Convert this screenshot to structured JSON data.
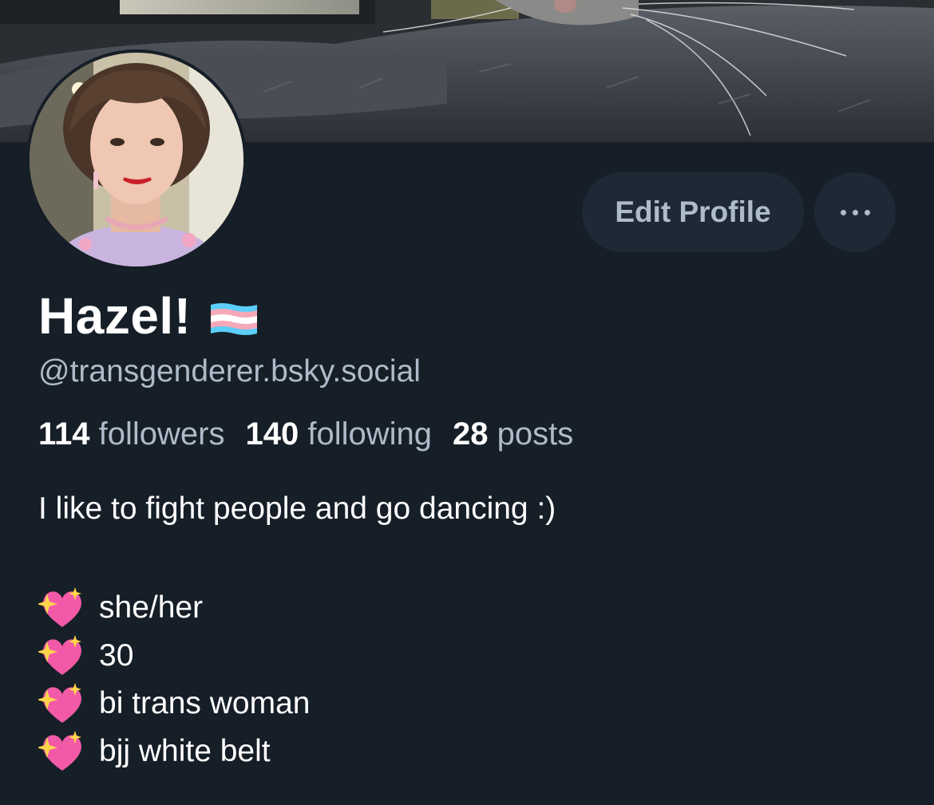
{
  "profile": {
    "display_name": "Hazel!",
    "handle": "@transgenderer.bsky.social",
    "bio_first_line": "I like to fight people and go dancing :)",
    "bio_items": [
      {
        "icon": "sparkling-heart-icon",
        "text": "she/her"
      },
      {
        "icon": "sparkling-heart-icon",
        "text": "30"
      },
      {
        "icon": "sparkling-heart-icon",
        "text": "bi trans woman"
      },
      {
        "icon": "sparkling-heart-icon",
        "text": "bjj white belt"
      }
    ]
  },
  "stats": {
    "followers_count": "114",
    "followers_label": "followers",
    "following_count": "140",
    "following_label": "following",
    "posts_count": "28",
    "posts_label": "posts"
  },
  "actions": {
    "edit_profile_label": "Edit Profile",
    "more_icon": "ellipsis-icon"
  },
  "colors": {
    "background": "#161e27",
    "button_bg": "#1e2936",
    "muted_text": "#aebbc9",
    "primary_text": "#ffffff",
    "flag_blue": "#5bcefa",
    "flag_pink": "#f5a9b8",
    "flag_white": "#ffffff"
  }
}
